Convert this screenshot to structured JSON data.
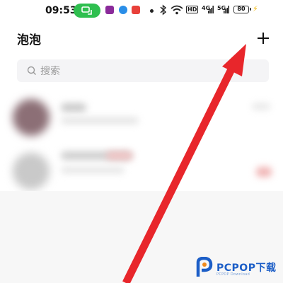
{
  "status_bar": {
    "time": "09:53",
    "battery_level": "80",
    "network_labels": [
      "HD",
      "4G",
      "5G"
    ],
    "icons": [
      "screen-mirror-icon",
      "app-icon",
      "browser-icon",
      "red-app-icon",
      "notification-dot-icon",
      "bluetooth-icon",
      "wifi-icon",
      "hd-icon",
      "signal-4g-icon",
      "signal-5g-icon",
      "battery-icon",
      "charging-icon"
    ],
    "pill_color": "#2fbf4f"
  },
  "header": {
    "title": "泡泡",
    "add_icon": "plus-icon"
  },
  "search": {
    "placeholder": "搜索",
    "icon": "search-icon"
  },
  "conversation_list": {
    "items_blurred": true
  },
  "annotation": {
    "arrow_color": "#e8262b"
  },
  "watermark": {
    "logo_text": "PCPOP下载",
    "sub_text": "PCPOP Download"
  }
}
